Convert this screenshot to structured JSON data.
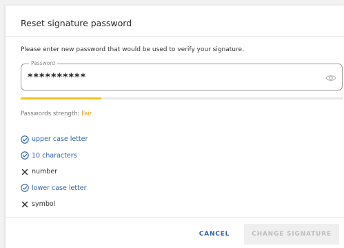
{
  "dialog": {
    "title": "Reset signature password",
    "instruction": "Please enter new password that would be used to verify your signature.",
    "password_field": {
      "label": "Password",
      "value": "**********",
      "icon": "eye-icon"
    },
    "strength": {
      "label": "Passwords strength:",
      "value": "Fair",
      "level_fraction": 0.25,
      "bar_color": "#f2c21b",
      "value_color": "#e29a1a"
    },
    "requirements": [
      {
        "label": "upper case letter",
        "met": true,
        "icon": "check-circle-icon"
      },
      {
        "label": "10 characters",
        "met": true,
        "icon": "check-circle-icon"
      },
      {
        "label": "number",
        "met": false,
        "icon": "cross-icon"
      },
      {
        "label": "lower case letter",
        "met": true,
        "icon": "check-circle-icon"
      },
      {
        "label": "symbol",
        "met": false,
        "icon": "cross-icon"
      }
    ],
    "buttons": {
      "cancel": "CANCEL",
      "change": "CHANGE SIGNATURE"
    },
    "colors": {
      "accent": "#2d5fa8",
      "disabled_text": "#bdbdbd"
    }
  }
}
